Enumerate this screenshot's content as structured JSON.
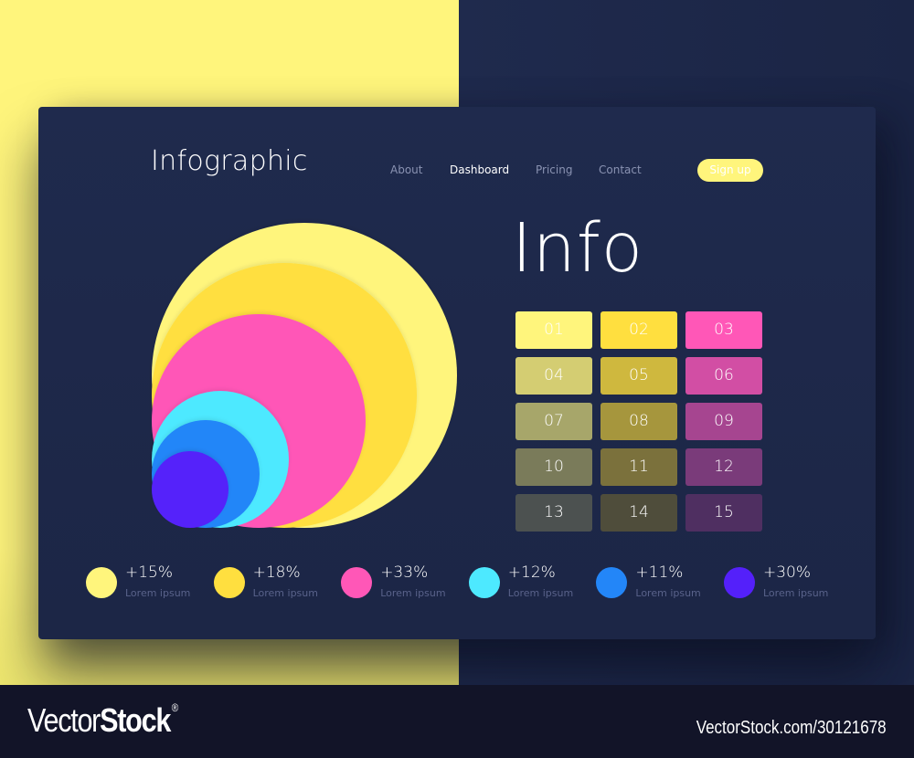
{
  "page": {
    "background_colors": {
      "yellow": "#fff57c",
      "navy": "#1d2747",
      "footer": "#121428"
    }
  },
  "header": {
    "brand": "Infographic",
    "nav": [
      {
        "label": "About",
        "active": false
      },
      {
        "label": "Dashboard",
        "active": true
      },
      {
        "label": "Pricing",
        "active": false
      },
      {
        "label": "Contact",
        "active": false
      }
    ],
    "signup_label": "Sign up",
    "accent_color": "#fff57c"
  },
  "info": {
    "title": "Info",
    "cells": [
      {
        "label": "01",
        "color": "#fff57c"
      },
      {
        "label": "02",
        "color": "#ffdf3f"
      },
      {
        "label": "03",
        "color": "#ff57b7"
      },
      {
        "label": "04",
        "color": "#d4cd72"
      },
      {
        "label": "05",
        "color": "#cfb83e"
      },
      {
        "label": "06",
        "color": "#d24ea4"
      },
      {
        "label": "07",
        "color": "#a7a66a"
      },
      {
        "label": "08",
        "color": "#a6963d"
      },
      {
        "label": "09",
        "color": "#a64590"
      },
      {
        "label": "10",
        "color": "#7a7b5a"
      },
      {
        "label": "11",
        "color": "#7b713c"
      },
      {
        "label": "12",
        "color": "#7a3b7a"
      },
      {
        "label": "13",
        "color": "#4c5150"
      },
      {
        "label": "14",
        "color": "#4f4d3b"
      },
      {
        "label": "15",
        "color": "#4f2f61"
      }
    ]
  },
  "chart_data": {
    "type": "bubble",
    "title": "",
    "series": [
      {
        "name": "Lorem ipsum",
        "value": 15,
        "label": "+15%",
        "color": "#fff57c"
      },
      {
        "name": "Lorem ipsum",
        "value": 18,
        "label": "+18%",
        "color": "#ffdf3f"
      },
      {
        "name": "Lorem ipsum",
        "value": 33,
        "label": "+33%",
        "color": "#ff57b7"
      },
      {
        "name": "Lorem ipsum",
        "value": 12,
        "label": "+12%",
        "color": "#4de9ff"
      },
      {
        "name": "Lorem ipsum",
        "value": 11,
        "label": "+11%",
        "color": "#2386f8"
      },
      {
        "name": "Lorem ipsum",
        "value": 30,
        "label": "+30%",
        "color": "#5420fa"
      }
    ],
    "legend_position": "bottom"
  },
  "watermark": {
    "logo_thin": "Vector",
    "logo_bold": "Stock",
    "logo_mark": "®",
    "reference": "VectorStock.com/30121678"
  }
}
